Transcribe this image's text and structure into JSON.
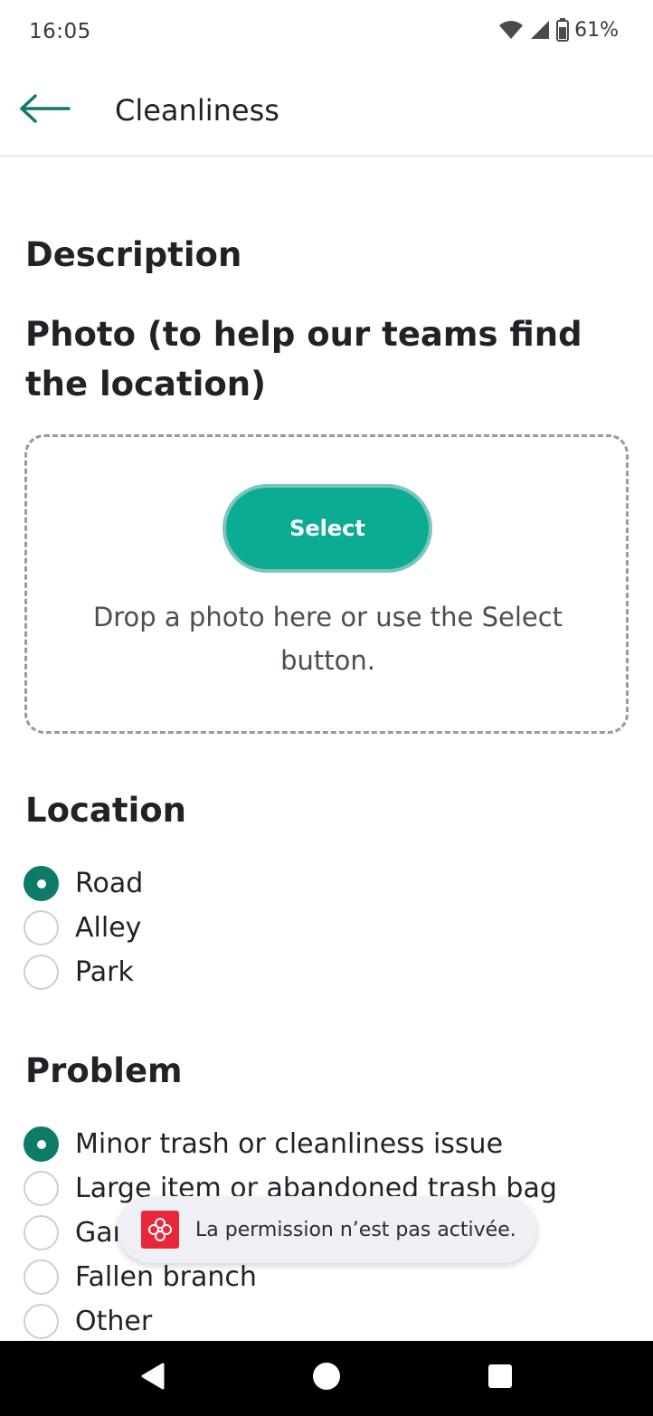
{
  "status_bar": {
    "time": "16:05",
    "battery_percent": "61%",
    "icons": [
      "wifi-icon",
      "cell-signal-icon",
      "battery-icon"
    ]
  },
  "app_bar": {
    "title": "Cleanliness",
    "back_icon": "arrow-left-icon"
  },
  "form": {
    "description_heading": "Description",
    "photo_heading": "Photo (to help our teams find the location)",
    "select_button_label": "Select",
    "dropzone_hint": "Drop a photo here or use the Select button.",
    "location_heading": "Location",
    "location_options": [
      {
        "label": "Road",
        "checked": true
      },
      {
        "label": "Alley",
        "checked": false
      },
      {
        "label": "Park",
        "checked": false
      }
    ],
    "problem_heading": "Problem",
    "problem_options": [
      {
        "label": "Minor trash or cleanliness issue",
        "checked": true
      },
      {
        "label": "Large item or abandoned trash bag",
        "checked": false
      },
      {
        "label": "Gar",
        "checked": false
      },
      {
        "label": "Fallen branch",
        "checked": false
      },
      {
        "label": "Other",
        "checked": false
      }
    ]
  },
  "toast": {
    "text": "La permission n’est pas activée.",
    "icon": "montreal-logo-icon"
  },
  "nav_bar": {
    "icons": [
      "nav-back-icon",
      "nav-home-icon",
      "nav-recents-icon"
    ]
  },
  "colors": {
    "accent": "#0cac94",
    "radio_checked": "#0e7a68",
    "toast_bg": "#eef0f6",
    "logo_red": "#e8283a"
  }
}
